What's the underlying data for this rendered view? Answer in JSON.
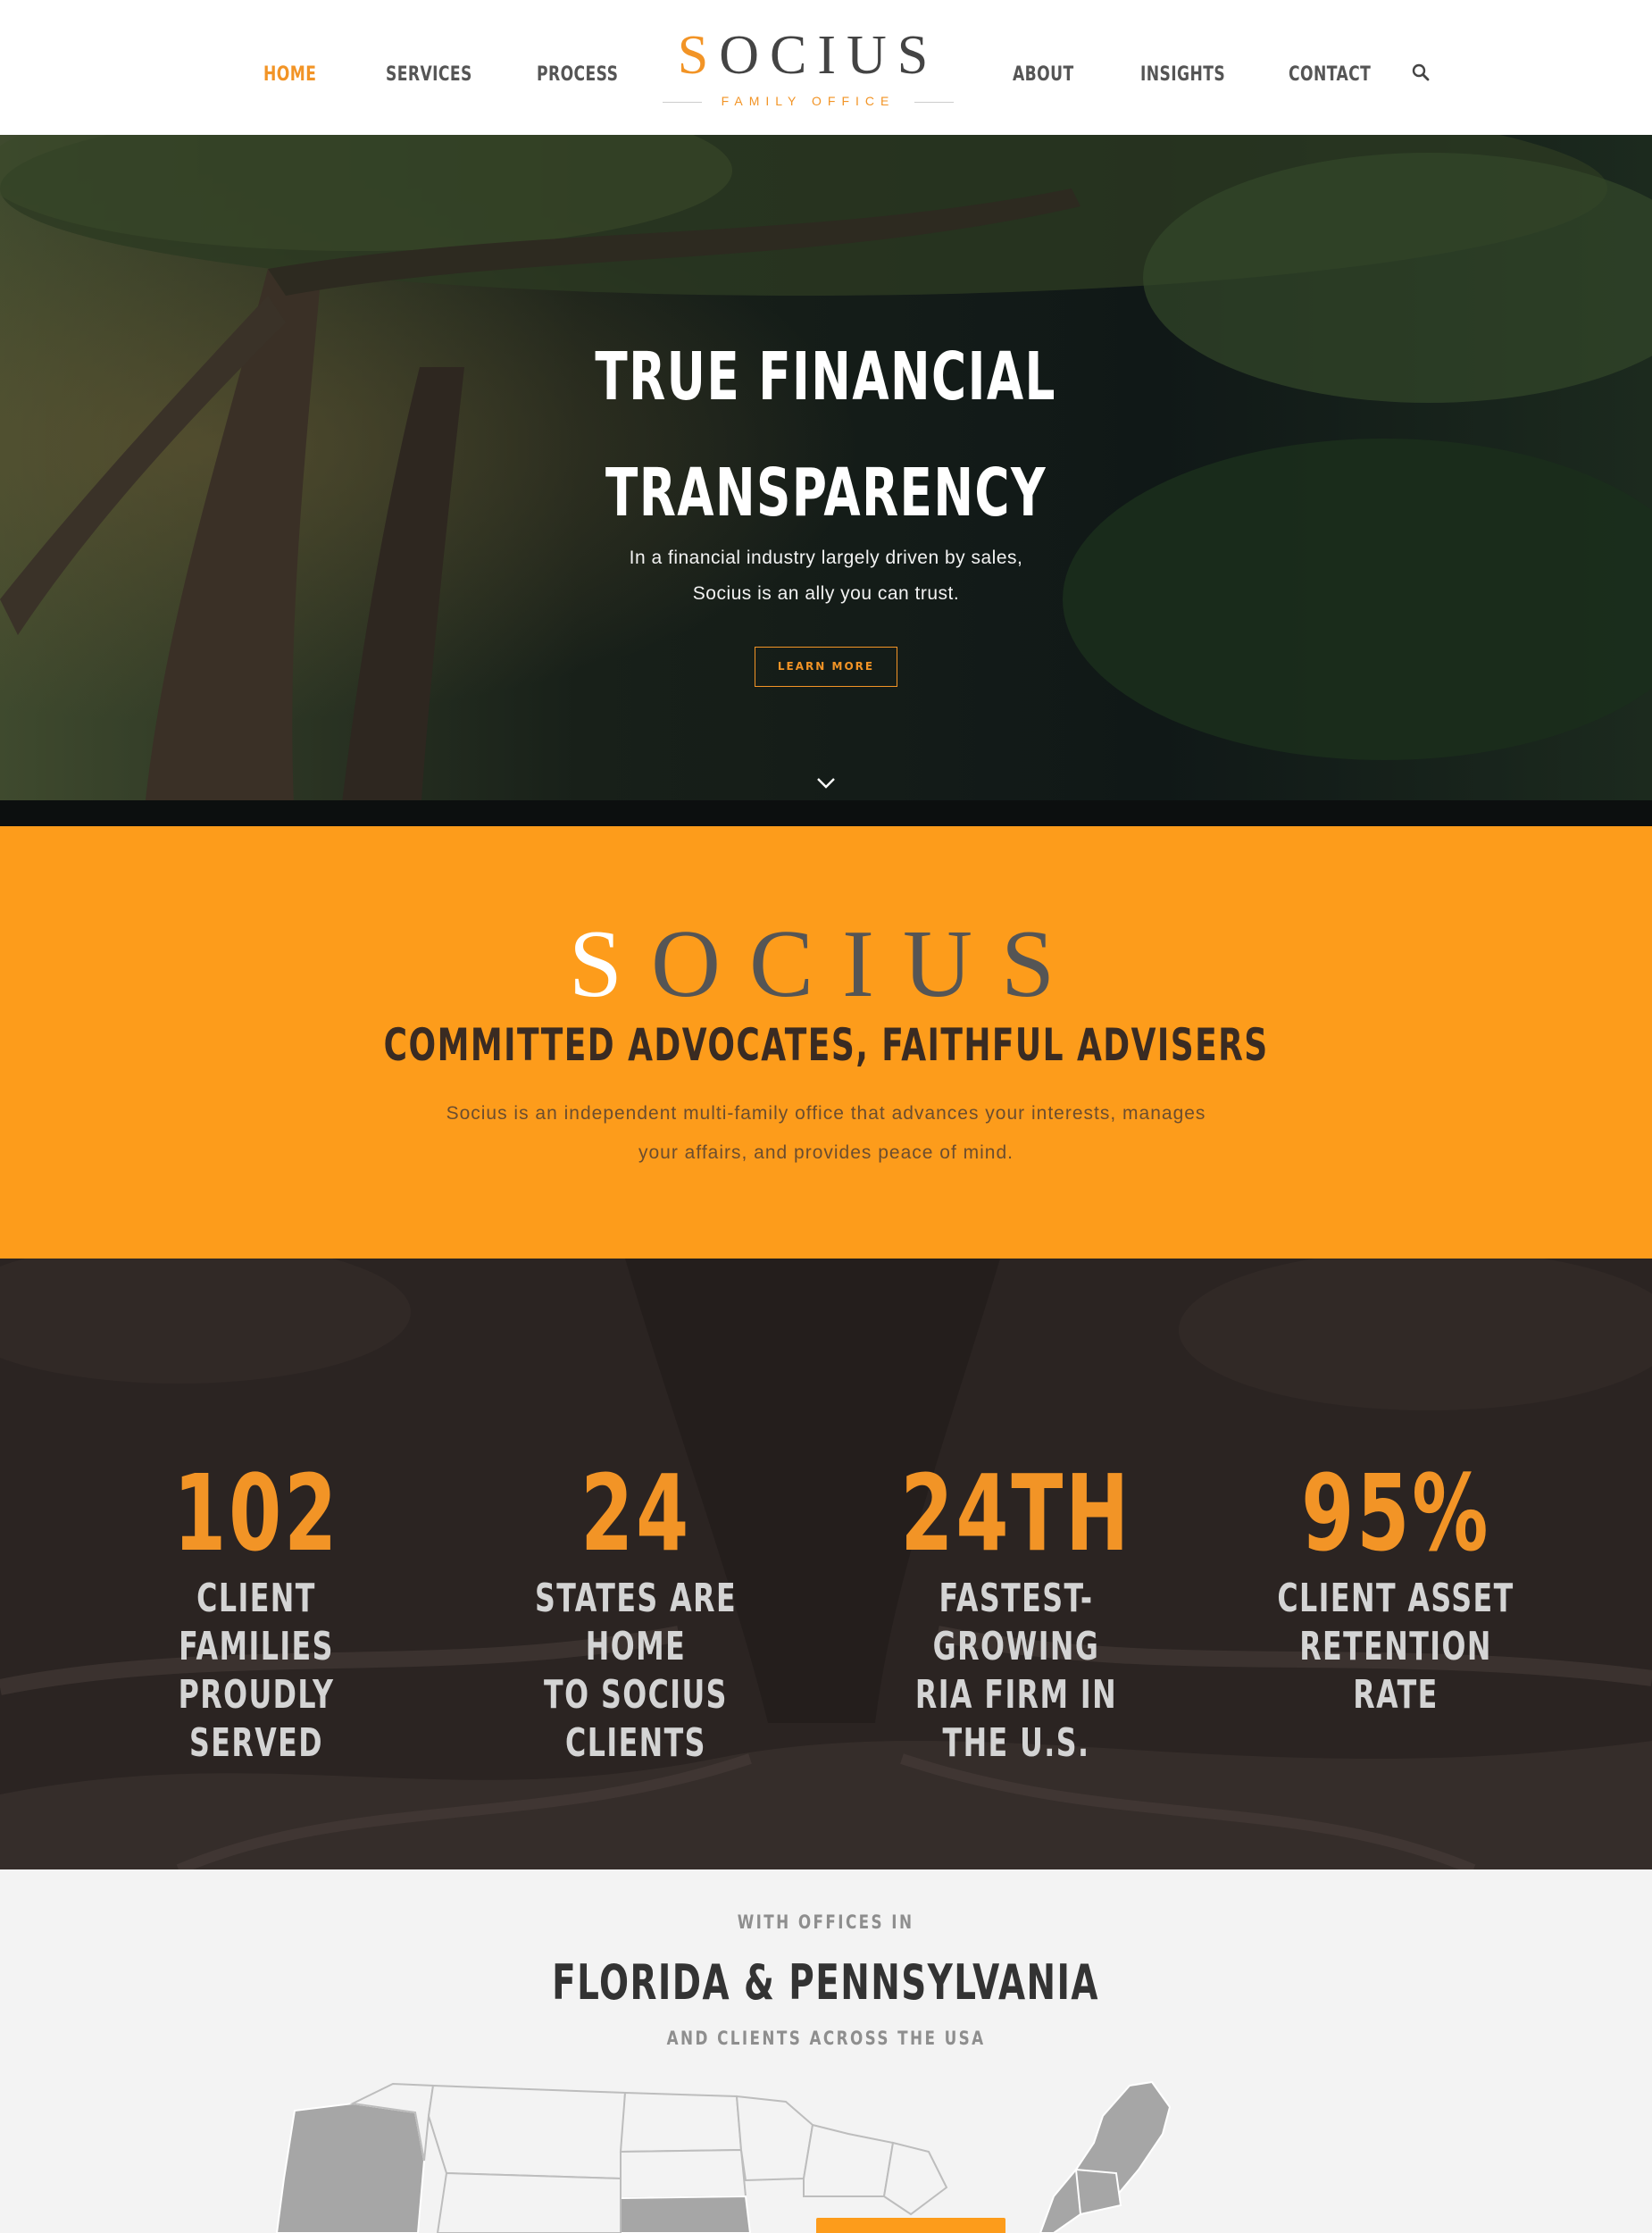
{
  "header": {
    "nav_left": [
      "HOME",
      "SERVICES",
      "PROCESS"
    ],
    "nav_right": [
      "ABOUT",
      "INSIGHTS",
      "CONTACT"
    ],
    "logo": {
      "initial": "S",
      "rest": "OCIUS",
      "subtitle": "FAMILY OFFICE"
    },
    "search_icon": "search-icon",
    "active_item": "HOME"
  },
  "hero": {
    "title_line1": "TRUE FINANCIAL",
    "title_line2": "TRANSPARENCY",
    "text_line1": "In a financial industry largely driven by sales,",
    "text_line2": "Socius is an ally you can trust.",
    "button_label": "LEARN MORE",
    "scroll_icon": "chevron-down-icon"
  },
  "intro": {
    "logo_initial": "S",
    "logo_rest": "OCIUS",
    "heading": "COMMITTED ADVOCATES, FAITHFUL ADVISERS",
    "text_line1": "Socius is an independent multi-family office that advances your interests, manages",
    "text_line2": "your affairs, and provides peace of mind."
  },
  "stats": [
    {
      "value": "102",
      "label": "CLIENT FAMILIES\nPROUDLY SERVED"
    },
    {
      "value": "24",
      "label": "STATES ARE HOME\nTO SOCIUS CLIENTS"
    },
    {
      "value": "24TH",
      "label": "FASTEST-GROWING\nRIA FIRM IN THE U.S."
    },
    {
      "value": "95%",
      "label": "CLIENT ASSET\nRETENTION RATE"
    }
  ],
  "offices": {
    "kicker": "WITH OFFICES IN",
    "heading": "FLORIDA & PENNSYLVANIA",
    "subtext": "AND CLIENTS ACROSS THE USA"
  },
  "colors": {
    "accent": "#f29426",
    "orange_band": "#fd9c1b",
    "nav_text": "#555555",
    "dark_heading": "#3a2b22"
  }
}
